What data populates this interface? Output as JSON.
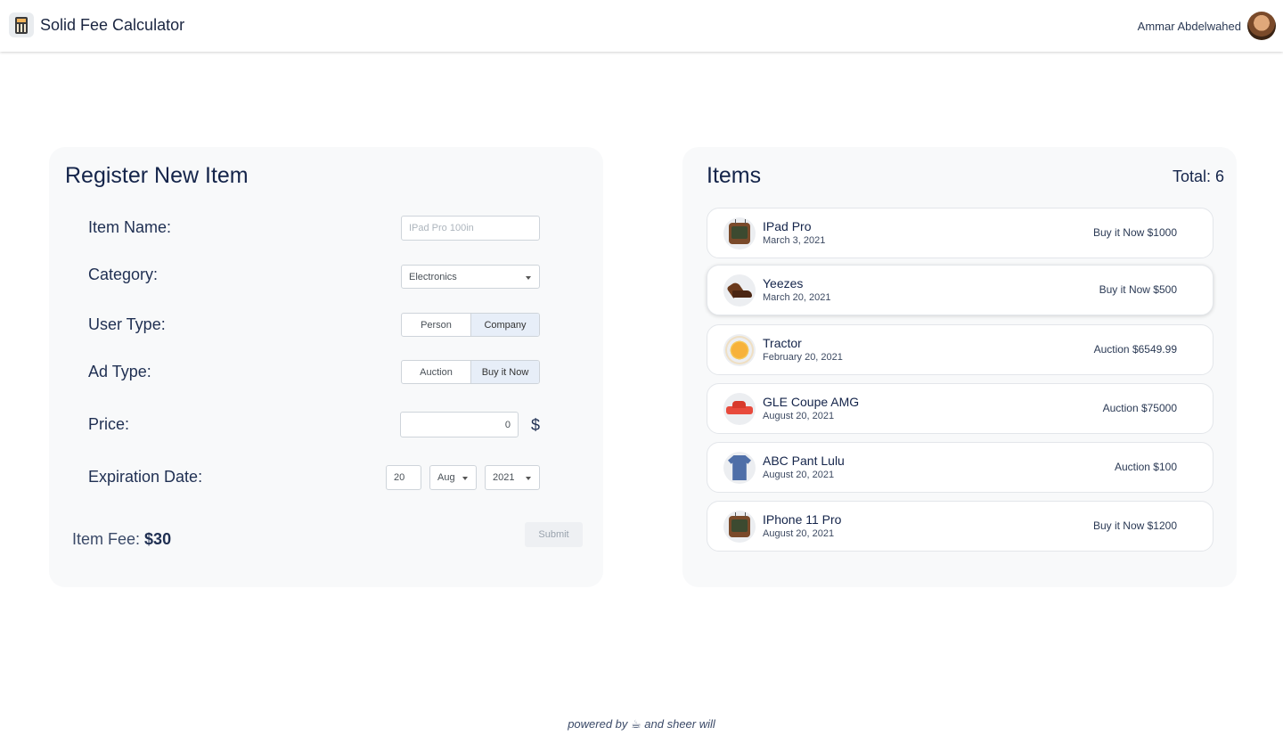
{
  "header": {
    "app_title": "Solid Fee Calculator",
    "app_icon": "calculator-icon",
    "user_name": "Ammar Abdelwahed"
  },
  "register": {
    "title": "Register New Item",
    "item_name_label": "Item Name:",
    "item_name_placeholder": "IPad Pro 100in",
    "category_label": "Category:",
    "category_value": "Electronics",
    "user_type_label": "User Type:",
    "user_type_options": [
      "Person",
      "Company"
    ],
    "user_type_selected": "Company",
    "ad_type_label": "Ad Type:",
    "ad_type_options": [
      "Auction",
      "Buy it Now"
    ],
    "ad_type_selected": "Buy it Now",
    "price_label": "Price:",
    "price_value": "0",
    "price_currency": "$",
    "expiration_label": "Expiration Date:",
    "expiration_day": "20",
    "expiration_month": "Aug",
    "expiration_year": "2021",
    "fee_label": "Item Fee:",
    "fee_value": "$30",
    "submit_label": "Submit"
  },
  "items": {
    "title": "Items",
    "total_label": "Total: 6",
    "list": [
      {
        "name": "IPad Pro",
        "date": "March 3, 2021",
        "price": "Buy it Now $1000",
        "icon": "television-icon"
      },
      {
        "name": "Yeezes",
        "date": "March 20, 2021",
        "price": "Buy it Now $500",
        "icon": "boot-icon"
      },
      {
        "name": "Tractor",
        "date": "February 20, 2021",
        "price": "Auction $6549.99",
        "icon": "sun-icon"
      },
      {
        "name": "GLE Coupe AMG",
        "date": "August 20, 2021",
        "price": "Auction $75000",
        "icon": "car-icon"
      },
      {
        "name": "ABC Pant Lulu",
        "date": "August 20, 2021",
        "price": "Auction $100",
        "icon": "shirt-icon"
      },
      {
        "name": "IPhone 11 Pro",
        "date": "August 20, 2021",
        "price": "Buy it Now $1200",
        "icon": "television-icon"
      }
    ]
  },
  "footer": {
    "text": "powered by ☕ and sheer will"
  }
}
